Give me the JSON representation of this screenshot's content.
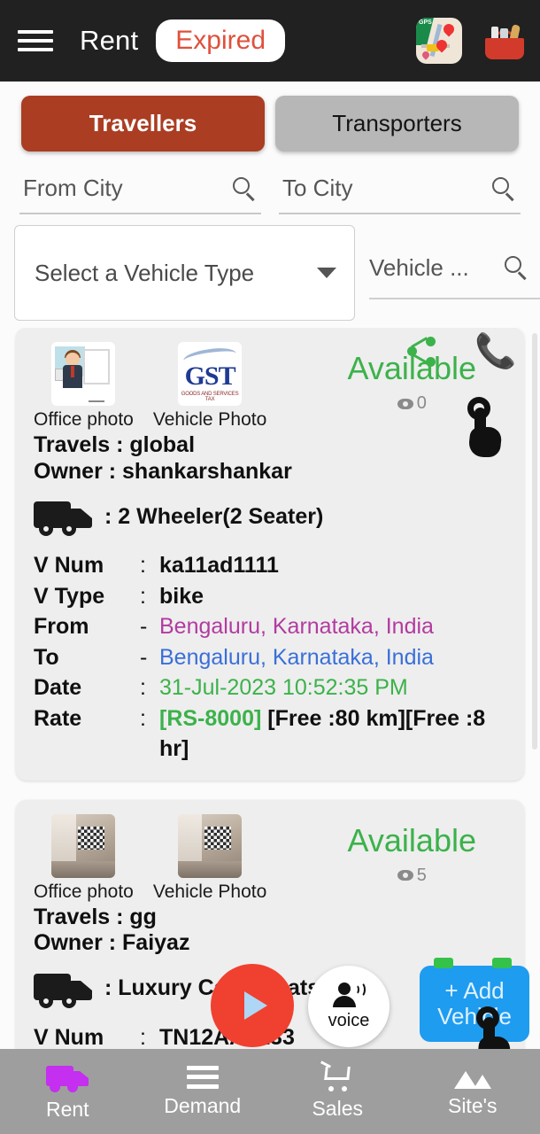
{
  "header": {
    "menu_icon": "hamburger-menu-icon",
    "title": "Rent",
    "badge": "Expired",
    "badge_color": "#e0503c",
    "icons": [
      {
        "name": "gps-map-icon",
        "label": "GPS"
      },
      {
        "name": "grocery-basket-icon",
        "label": ""
      }
    ]
  },
  "tabs": [
    {
      "label": "Travellers",
      "active": true,
      "color": "#ab3d22"
    },
    {
      "label": "Transporters",
      "active": false,
      "color": "#b7b7b7"
    }
  ],
  "filters": {
    "from_city_placeholder": "From City",
    "to_city_placeholder": "To City",
    "vehicle_type_placeholder": "Select a Vehicle Type",
    "vehicle_search_placeholder": "Vehicle ...",
    "search_icon": "search-icon",
    "dropdown_icon": "chevron-down-icon"
  },
  "cards": [
    {
      "office_photo_caption": "Office photo",
      "vehicle_photo_caption": "Vehicle Photo",
      "office_photo_alt": "office-presentation-photo",
      "vehicle_photo_alt": "gst-logo-photo",
      "status": "Available",
      "status_color": "#3cb24b",
      "views": "0",
      "travels_label": "Travels",
      "travels_value": ": global",
      "owner_label": "Owner",
      "owner_value": ": shankarshankar",
      "vehicle_text": ": 2 Wheeler(2 Seater)",
      "rows": [
        {
          "label": "V Num",
          "sep": ":",
          "value": "ka11ad1111",
          "color": "black"
        },
        {
          "label": "V Type",
          "sep": ":",
          "value": "bike",
          "color": "black"
        },
        {
          "label": "From",
          "sep": "-",
          "value": "Bengaluru, Karnataka, India",
          "color": "purple"
        },
        {
          "label": "To",
          "sep": "-",
          "value": "Bengaluru, Karnataka, India",
          "color": "blue"
        },
        {
          "label": "Date",
          "sep": ":",
          "value": "31-Jul-2023 10:52:35 PM",
          "color": "green"
        }
      ],
      "rate_label": "Rate",
      "rate_sep": ":",
      "rate_amount": "[RS-8000]",
      "rate_rest": "[Free :80 km][Free  :8 hr]",
      "share_icon": "share-icon",
      "call_icon": "phone-call-icon",
      "tap_icon": "tap-hand-cursor-icon"
    },
    {
      "office_photo_caption": "Office photo",
      "vehicle_photo_caption": "Vehicle Photo",
      "office_photo_alt": "room-interior-photo",
      "vehicle_photo_alt": "room-interior-photo",
      "status": "Available",
      "status_color": "#3cb24b",
      "views": "5",
      "travels_label": "Travels",
      "travels_value": ": gg",
      "owner_label": "Owner",
      "owner_value": ": Faiyaz",
      "vehicle_text": ": Luxury Car(5 Seats)",
      "rows": [
        {
          "label": "V Num",
          "sep": ":",
          "value": "TN12AA2133",
          "color": "black"
        }
      ]
    }
  ],
  "fabs": {
    "play_label": "play-button",
    "voice_label": "voice",
    "voice_icon": "person-speaking-icon",
    "add_vehicle_label": "+ Add Vehicle",
    "add_vehicle_color": "#1e9cf0",
    "tap_icon": "tap-hand-cursor-icon"
  },
  "bottom_nav": [
    {
      "label": "Rent",
      "icon": "truck-icon",
      "active": true,
      "color": "#c42ff0"
    },
    {
      "label": "Demand",
      "icon": "menu-lines-icon",
      "active": false
    },
    {
      "label": "Sales",
      "icon": "shopping-cart-icon",
      "active": false
    },
    {
      "label": "Site's",
      "icon": "mountains-icon",
      "active": false
    }
  ]
}
